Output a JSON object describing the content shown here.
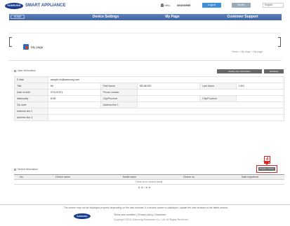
{
  "header": {
    "logo_text": "SAMSUNG",
    "brand": "SMART APPLIANCE",
    "hello": "Hello,",
    "username": "SEUNGEEE",
    "btn1": "Logout",
    "btn2": "Modify",
    "lang": "English"
  },
  "nav": {
    "home": "HOME",
    "items": [
      "Device Settings",
      "My Page",
      "Customer Support"
    ]
  },
  "page": {
    "title": "My page",
    "breadcrumb": "Home > My page > My page"
  },
  "user_info": {
    "section": "User information",
    "btn_modify": "Modify user information",
    "btn_withdraw": "Withdraw",
    "rows": [
      {
        "l1": "E-Mail",
        "v1": "sample.ch@samsung.com",
        "l2": "",
        "v2": "",
        "l3": "",
        "v3": ""
      },
      {
        "l1": "Title",
        "v1": "Mr",
        "l2": "First Name",
        "v2": "SEUNGEE",
        "l3": "Last Name",
        "v3": "CHO"
      },
      {
        "l1": "Date of birth",
        "v1": "07/12/1971",
        "l2": "Phone number",
        "v2": "",
        "l3": "",
        "v3": ""
      },
      {
        "l1": "Nationality",
        "v1": "KOR",
        "l2": "City/Province",
        "v2": "",
        "l3": "City/Province",
        "v3": ""
      },
      {
        "l1": "Zip code",
        "v1": "",
        "l2": "Address line 1",
        "v2": "",
        "l3": "",
        "v3": ""
      },
      {
        "l1": "Address line 2",
        "v1": "",
        "l2": "",
        "v2": "",
        "l3": "",
        "v3": ""
      },
      {
        "l1": "Address line 3",
        "v1": "",
        "l2": "",
        "v2": "",
        "l3": "",
        "v3": ""
      }
    ]
  },
  "device_info": {
    "section": "Device information",
    "btn_register": "Register device",
    "columns": [
      "No.",
      "Device name",
      "Model name",
      "Device no.",
      "Date registered"
    ],
    "no_result": "There is no search result.",
    "pager": "◀ ◀ 1 ▶ ▶"
  },
  "annotation": {
    "badge": "4"
  },
  "footer": {
    "note": "The screen may not be displayed properly depending on the web browser. If a broken screen is displayed, update the web browser to the latest version.",
    "logo": "SAMSUNG",
    "links": "Terms and condition | Privacy policy | Disclaimer",
    "copyright": "Copyright ©2011 Samsung Electronics Co., Ltd. All Rights Reserved."
  },
  "colors": {
    "nav": "#4a6fae",
    "brand": "#1a3c8e",
    "highlight": "#dd2222"
  }
}
